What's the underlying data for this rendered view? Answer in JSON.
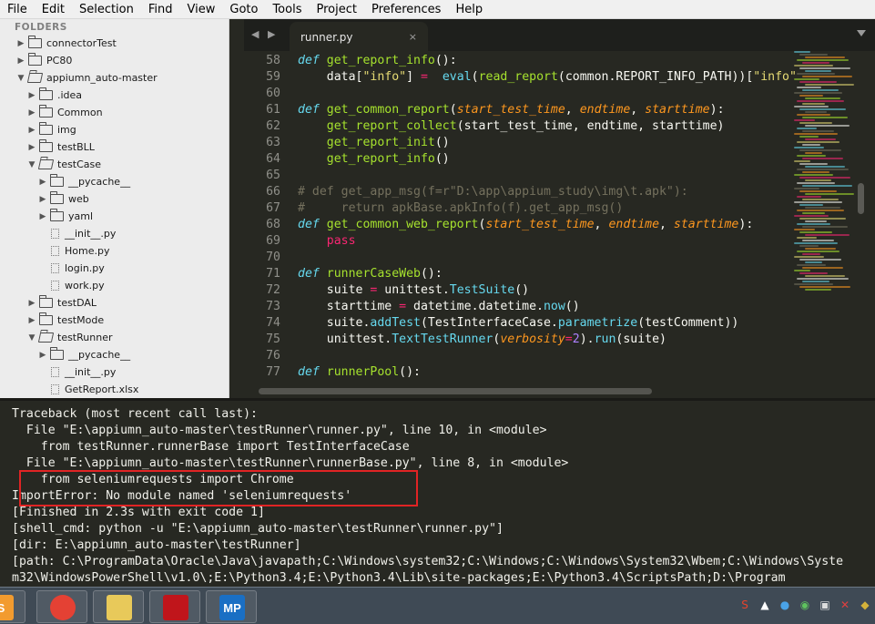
{
  "menubar": {
    "items": [
      "File",
      "Edit",
      "Selection",
      "Find",
      "View",
      "Goto",
      "Tools",
      "Project",
      "Preferences",
      "Help"
    ]
  },
  "sidebar": {
    "folders_label": "FOLDERS",
    "tree": [
      {
        "label": "connectorTest",
        "kind": "folder",
        "expanded": false,
        "depth": 0
      },
      {
        "label": "PC80",
        "kind": "folder",
        "expanded": false,
        "depth": 0
      },
      {
        "label": "appiumn_auto-master",
        "kind": "folder",
        "expanded": true,
        "depth": 0
      },
      {
        "label": ".idea",
        "kind": "folder",
        "expanded": false,
        "depth": 1
      },
      {
        "label": "Common",
        "kind": "folder",
        "expanded": false,
        "depth": 1
      },
      {
        "label": "img",
        "kind": "folder",
        "expanded": false,
        "depth": 1
      },
      {
        "label": "testBLL",
        "kind": "folder",
        "expanded": false,
        "depth": 1
      },
      {
        "label": "testCase",
        "kind": "folder",
        "expanded": true,
        "depth": 1
      },
      {
        "label": "__pycache__",
        "kind": "folder",
        "expanded": false,
        "depth": 2
      },
      {
        "label": "web",
        "kind": "folder",
        "expanded": false,
        "depth": 2
      },
      {
        "label": "yaml",
        "kind": "folder",
        "expanded": false,
        "depth": 2
      },
      {
        "label": "__init__.py",
        "kind": "file",
        "depth": 2
      },
      {
        "label": "Home.py",
        "kind": "file",
        "depth": 2
      },
      {
        "label": "login.py",
        "kind": "file",
        "depth": 2
      },
      {
        "label": "work.py",
        "kind": "file",
        "depth": 2
      },
      {
        "label": "testDAL",
        "kind": "folder",
        "expanded": false,
        "depth": 1
      },
      {
        "label": "testMode",
        "kind": "folder",
        "expanded": false,
        "depth": 1
      },
      {
        "label": "testRunner",
        "kind": "folder",
        "expanded": true,
        "depth": 1
      },
      {
        "label": "__pycache__",
        "kind": "folder",
        "expanded": false,
        "depth": 2
      },
      {
        "label": "__init__.py",
        "kind": "file",
        "depth": 2
      },
      {
        "label": "GetReport.xlsx",
        "kind": "file",
        "depth": 2
      }
    ]
  },
  "tabbar": {
    "nav": "◀ ▶",
    "active_tab": "runner.py",
    "close": "×"
  },
  "editor": {
    "lines": [
      {
        "n": "58",
        "tokens": [
          [
            "kw",
            "def "
          ],
          [
            "fn",
            "get_report_info"
          ],
          [
            "",
            "():"
          ]
        ]
      },
      {
        "n": "59",
        "tokens": [
          [
            "",
            "    data["
          ],
          [
            "st",
            "\"info\""
          ],
          [
            "",
            "] "
          ],
          [
            "op",
            "="
          ],
          [
            "",
            "  "
          ],
          [
            "bi",
            "eval"
          ],
          [
            "",
            "("
          ],
          [
            "fn",
            "read_report"
          ],
          [
            "",
            "(common.REPORT_INFO_PATH))["
          ],
          [
            "st",
            "\"info\""
          ]
        ]
      },
      {
        "n": "60",
        "tokens": []
      },
      {
        "n": "61",
        "tokens": [
          [
            "kw",
            "def "
          ],
          [
            "fn",
            "get_common_report"
          ],
          [
            "",
            "("
          ],
          [
            "pm",
            "start_test_time"
          ],
          [
            "",
            ", "
          ],
          [
            "pm",
            "endtime"
          ],
          [
            "",
            ", "
          ],
          [
            "pm",
            "starttime"
          ],
          [
            "",
            "):"
          ]
        ]
      },
      {
        "n": "62",
        "tokens": [
          [
            "",
            "    "
          ],
          [
            "fn",
            "get_report_collect"
          ],
          [
            "",
            "(start_test_time, endtime, starttime)"
          ]
        ]
      },
      {
        "n": "63",
        "tokens": [
          [
            "",
            "    "
          ],
          [
            "fn",
            "get_report_init"
          ],
          [
            "",
            "()"
          ]
        ]
      },
      {
        "n": "64",
        "tokens": [
          [
            "",
            "    "
          ],
          [
            "fn",
            "get_report_info"
          ],
          [
            "",
            "()"
          ]
        ]
      },
      {
        "n": "65",
        "tokens": []
      },
      {
        "n": "66",
        "tokens": [
          [
            "cm",
            "# def get_app_msg(f=r\"D:\\app\\appium_study\\img\\t.apk\"):"
          ]
        ]
      },
      {
        "n": "67",
        "tokens": [
          [
            "cm",
            "#     return apkBase.apkInfo(f).get_app_msg()"
          ]
        ]
      },
      {
        "n": "68",
        "tokens": [
          [
            "kw",
            "def "
          ],
          [
            "fn",
            "get_common_web_report"
          ],
          [
            "",
            "("
          ],
          [
            "pm",
            "start_test_time"
          ],
          [
            "",
            ", "
          ],
          [
            "pm",
            "endtime"
          ],
          [
            "",
            ", "
          ],
          [
            "pm",
            "starttime"
          ],
          [
            "",
            "):"
          ]
        ]
      },
      {
        "n": "69",
        "tokens": [
          [
            "",
            "    "
          ],
          [
            "op",
            "pass"
          ]
        ]
      },
      {
        "n": "70",
        "tokens": []
      },
      {
        "n": "71",
        "tokens": [
          [
            "kw",
            "def "
          ],
          [
            "fn",
            "runnerCaseWeb"
          ],
          [
            "",
            "():"
          ]
        ]
      },
      {
        "n": "72",
        "tokens": [
          [
            "",
            "    suite "
          ],
          [
            "op",
            "="
          ],
          [
            "",
            " unittest."
          ],
          [
            "bi",
            "TestSuite"
          ],
          [
            "",
            "()"
          ]
        ]
      },
      {
        "n": "73",
        "tokens": [
          [
            "",
            "    starttime "
          ],
          [
            "op",
            "="
          ],
          [
            "",
            " datetime.datetime."
          ],
          [
            "bi",
            "now"
          ],
          [
            "",
            "()"
          ]
        ]
      },
      {
        "n": "74",
        "tokens": [
          [
            "",
            "    suite."
          ],
          [
            "bi",
            "addTest"
          ],
          [
            "",
            "(TestInterfaceCase."
          ],
          [
            "bi",
            "parametrize"
          ],
          [
            "",
            "(testComment))"
          ]
        ]
      },
      {
        "n": "75",
        "tokens": [
          [
            "",
            "    unittest."
          ],
          [
            "bi",
            "TextTestRunner"
          ],
          [
            "",
            "("
          ],
          [
            "pm",
            "verbosity"
          ],
          [
            "op",
            "="
          ],
          [
            "nm",
            "2"
          ],
          [
            "",
            ")."
          ],
          [
            "bi",
            "run"
          ],
          [
            "",
            "(suite)"
          ]
        ]
      },
      {
        "n": "76",
        "tokens": []
      },
      {
        "n": "77",
        "tokens": [
          [
            "kw",
            "def "
          ],
          [
            "fn",
            "runnerPool"
          ],
          [
            "",
            "():"
          ]
        ]
      }
    ]
  },
  "console": {
    "lines": [
      "Traceback (most recent call last):",
      "  File \"E:\\appiumn_auto-master\\testRunner\\runner.py\", line 10, in <module>",
      "    from testRunner.runnerBase import TestInterfaceCase",
      "  File \"E:\\appiumn_auto-master\\testRunner\\runnerBase.py\", line 8, in <module>",
      "    from seleniumrequests import Chrome",
      "ImportError: No module named 'seleniumrequests'",
      "[Finished in 2.3s with exit code 1]",
      "[shell_cmd: python -u \"E:\\appiumn_auto-master\\testRunner\\runner.py\"]",
      "[dir: E:\\appiumn_auto-master\\testRunner]",
      "[path: C:\\ProgramData\\Oracle\\Java\\javapath;C:\\Windows\\system32;C:\\Windows;C:\\Windows\\System32\\Wbem;C:\\Windows\\Syste",
      "m32\\WindowsPowerShell\\v1.0\\;E:\\Python3.4;E:\\Python3.4\\Lib\\site-packages;E:\\Python3.4\\ScriptsPath;D:\\Program"
    ]
  },
  "taskbar": {
    "apps": [
      {
        "name": "sublime-text-app-icon",
        "glyph": "S",
        "color": "#f29b2f"
      },
      {
        "name": "chrome-app-icon",
        "glyph": "",
        "color": "#e44134"
      },
      {
        "name": "file-explorer-app-icon",
        "glyph": "",
        "color": "#e8c95a"
      },
      {
        "name": "adobe-reader-app-icon",
        "glyph": "",
        "color": "#c0151b"
      },
      {
        "name": "mp-app-icon",
        "glyph": "MP",
        "color": "#1a6fc4"
      }
    ],
    "tray_icons": [
      "sogou-input-icon",
      "chevron-up-icon",
      "qq-icon",
      "wechat-icon",
      "network-icon",
      "volume-muted-icon",
      "security-icon"
    ]
  },
  "colors": {
    "editor_bg": "#272822",
    "keyword": "#66d9ef",
    "function": "#a6e22e",
    "string": "#e6db74",
    "param": "#fd971f",
    "operator": "#f92672",
    "comment": "#75715e",
    "highlight_box": "#e02424"
  }
}
